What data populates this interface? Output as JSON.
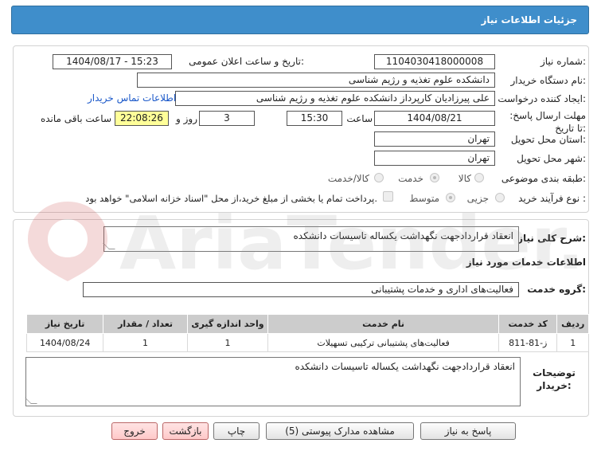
{
  "header": {
    "title": "جزئیات اطلاعات نیاز"
  },
  "fields": {
    "need_number_label": "شماره نیاز:",
    "need_number": "1104030418000008",
    "announce_label": "تاریخ و ساعت اعلان عمومی:",
    "announce_value": "1404/08/17 - 15:23",
    "buyer_org_label": "نام دستگاه خریدار:",
    "buyer_org": "دانشکده علوم تغذیه و رژیم شناسی",
    "creator_label": "ایجاد کننده درخواست:",
    "creator": "علی پیرزادیان کارپرداز دانشکده علوم تغذیه و رژیم شناسی",
    "contact_link": "اطلاعات تماس خریدار",
    "deadline_label": "مهلت ارسال پاسخ: تا تاریخ:",
    "deadline_date": "1404/08/21",
    "hour_label": "ساعت",
    "deadline_time": "15:30",
    "days_value": "3",
    "days_label": "روز و",
    "remaining_time": "22:08:26",
    "remaining_label": "ساعت باقی مانده",
    "province_label": "استان محل تحویل:",
    "province": "تهران",
    "city_label": "شهر محل تحویل:",
    "city": "تهران",
    "category_label": "طبقه بندی موضوعی:",
    "category_options": [
      "کالا",
      "خدمت",
      "کالا/خدمت"
    ],
    "process_label": "نوع فرآیند خرید :",
    "process_options": [
      "جزیی",
      "متوسط"
    ],
    "payment_note": "پرداخت تمام یا بخشی از مبلغ خرید،از محل \"اسناد خزانه اسلامی\" خواهد بود."
  },
  "summary": {
    "label": "شرح کلی نیاز:",
    "text": "انعقاد قراردادجهت نگهداشت یکساله تاسیسات دانشکده"
  },
  "services": {
    "section_title": "اطلاعات خدمات مورد نیاز",
    "group_label": "گروه خدمت:",
    "group_value": "فعالیت‌های اداری و خدمات پشتیبانی",
    "columns": [
      "ردیف",
      "کد خدمت",
      "نام خدمت",
      "واحد اندازه گیری",
      "تعداد / مقدار",
      "تاریخ نیاز"
    ],
    "rows": [
      [
        "1",
        "ز-81-811",
        "فعالیت‌های پشتیبانی ترکیبی تسهیلات",
        "1",
        "1",
        "1404/08/24"
      ]
    ]
  },
  "buyer_notes": {
    "label": "توضیحات خریدار:",
    "text": "انعقاد قراردادجهت نگهداشت یکساله تاسیسات دانشکده"
  },
  "buttons": {
    "reply": "پاسخ به نیاز",
    "attachments": "مشاهده مدارک پیوستی (5)",
    "print": "چاپ",
    "back": "بازگشت",
    "exit": "خروج"
  },
  "watermark": {
    "text": "AriaTender.net"
  },
  "colors": {
    "header": "#3f8ecb",
    "link": "#1a58c9",
    "highlight": "#ffff99"
  }
}
